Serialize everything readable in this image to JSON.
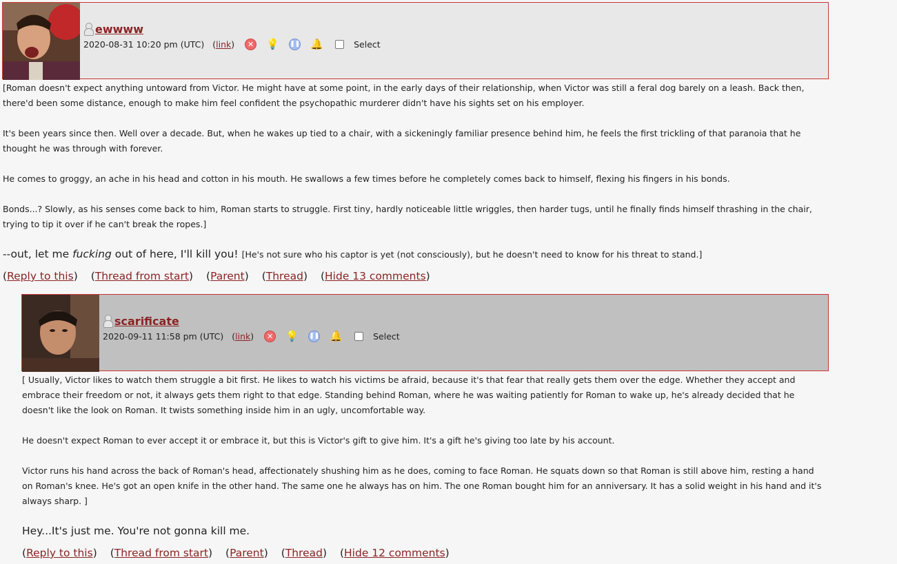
{
  "comments": [
    {
      "username": "ewwww",
      "timestamp": "2020-08-31 10:20 pm (UTC)",
      "link_label": "link",
      "select_label": "Select",
      "paragraphs": [
        "[Roman doesn't expect anything untoward from Victor. He might have at some point, in the early days of their relationship, when Victor was still a feral dog barely on a leash. Back then, there'd been some distance, enough to make him feel confident the psychopathic murderer didn't have his sights set on his employer.",
        "It's been years since then. Well over a decade. But, when he wakes up tied to a chair, with a sickeningly familiar presence behind him, he feels the first trickling of that paranoia that he thought he was through with forever.",
        "He comes to groggy, an ache in his head and cotton in his mouth. He swallows a few times before he completely comes back to himself, flexing his fingers in his bonds.",
        "Bonds...? Slowly, as his senses come back to him, Roman starts to struggle. First tiny, hardly noticeable little wriggles, then harder tugs, until he finally finds himself thrashing in the chair, trying to tip it over if he can't break the ropes.]"
      ],
      "dialogue_before": "--out, let me ",
      "dialogue_em": "fucking",
      "dialogue_after": " out of here, I'll kill you!",
      "narration": "[He's not sure who his captor is yet (not consciously), but he doesn't need to know for his threat to stand.]",
      "actions": {
        "reply": "Reply to this",
        "thread_start": "Thread from start",
        "parent": "Parent",
        "thread": "Thread",
        "hide": "Hide 13 comments"
      },
      "header_bg": "#e8e8e8"
    },
    {
      "username": "scarificate",
      "timestamp": "2020-09-11 11:58 pm (UTC)",
      "link_label": "link",
      "select_label": "Select",
      "paragraphs": [
        "[ Usually, Victor likes to watch them struggle a bit first. He likes to watch his victims be afraid, because it's that fear that really gets them over the edge. Whether they accept and embrace their freedom or not, it always gets them right to that edge. Standing behind Roman, where he was waiting patiently for Roman to wake up, he's already decided that he doesn't like the look on Roman. It twists something inside him in an ugly, uncomfortable way.",
        "He doesn't expect Roman to ever accept it or embrace it, but this is Victor's gift to give him. It's a gift he's giving too late by his account.",
        "Victor runs his hand across the back of Roman's head, affectionately shushing him as he does, coming to face Roman. He squats down so that Roman is still above him, resting a hand on Roman's knee. He's got an open knife in the other hand. The same one he always has on him. The one Roman bought him for an anniversary. It has a solid weight in his hand and it's always sharp. ]"
      ],
      "dialogue": "Hey...It's just me. You're not gonna kill me.",
      "actions": {
        "reply": "Reply to this",
        "thread_start": "Thread from start",
        "parent": "Parent",
        "thread": "Thread",
        "hide": "Hide 12 comments"
      },
      "header_bg": "#c0c0c0"
    }
  ],
  "colors": {
    "link": "#8b2323",
    "header_border": "#cc3333",
    "page_bg": "#f6f6f6"
  },
  "icons": [
    "user-icon",
    "delete-icon",
    "screen-icon",
    "freeze-icon",
    "track-icon"
  ]
}
